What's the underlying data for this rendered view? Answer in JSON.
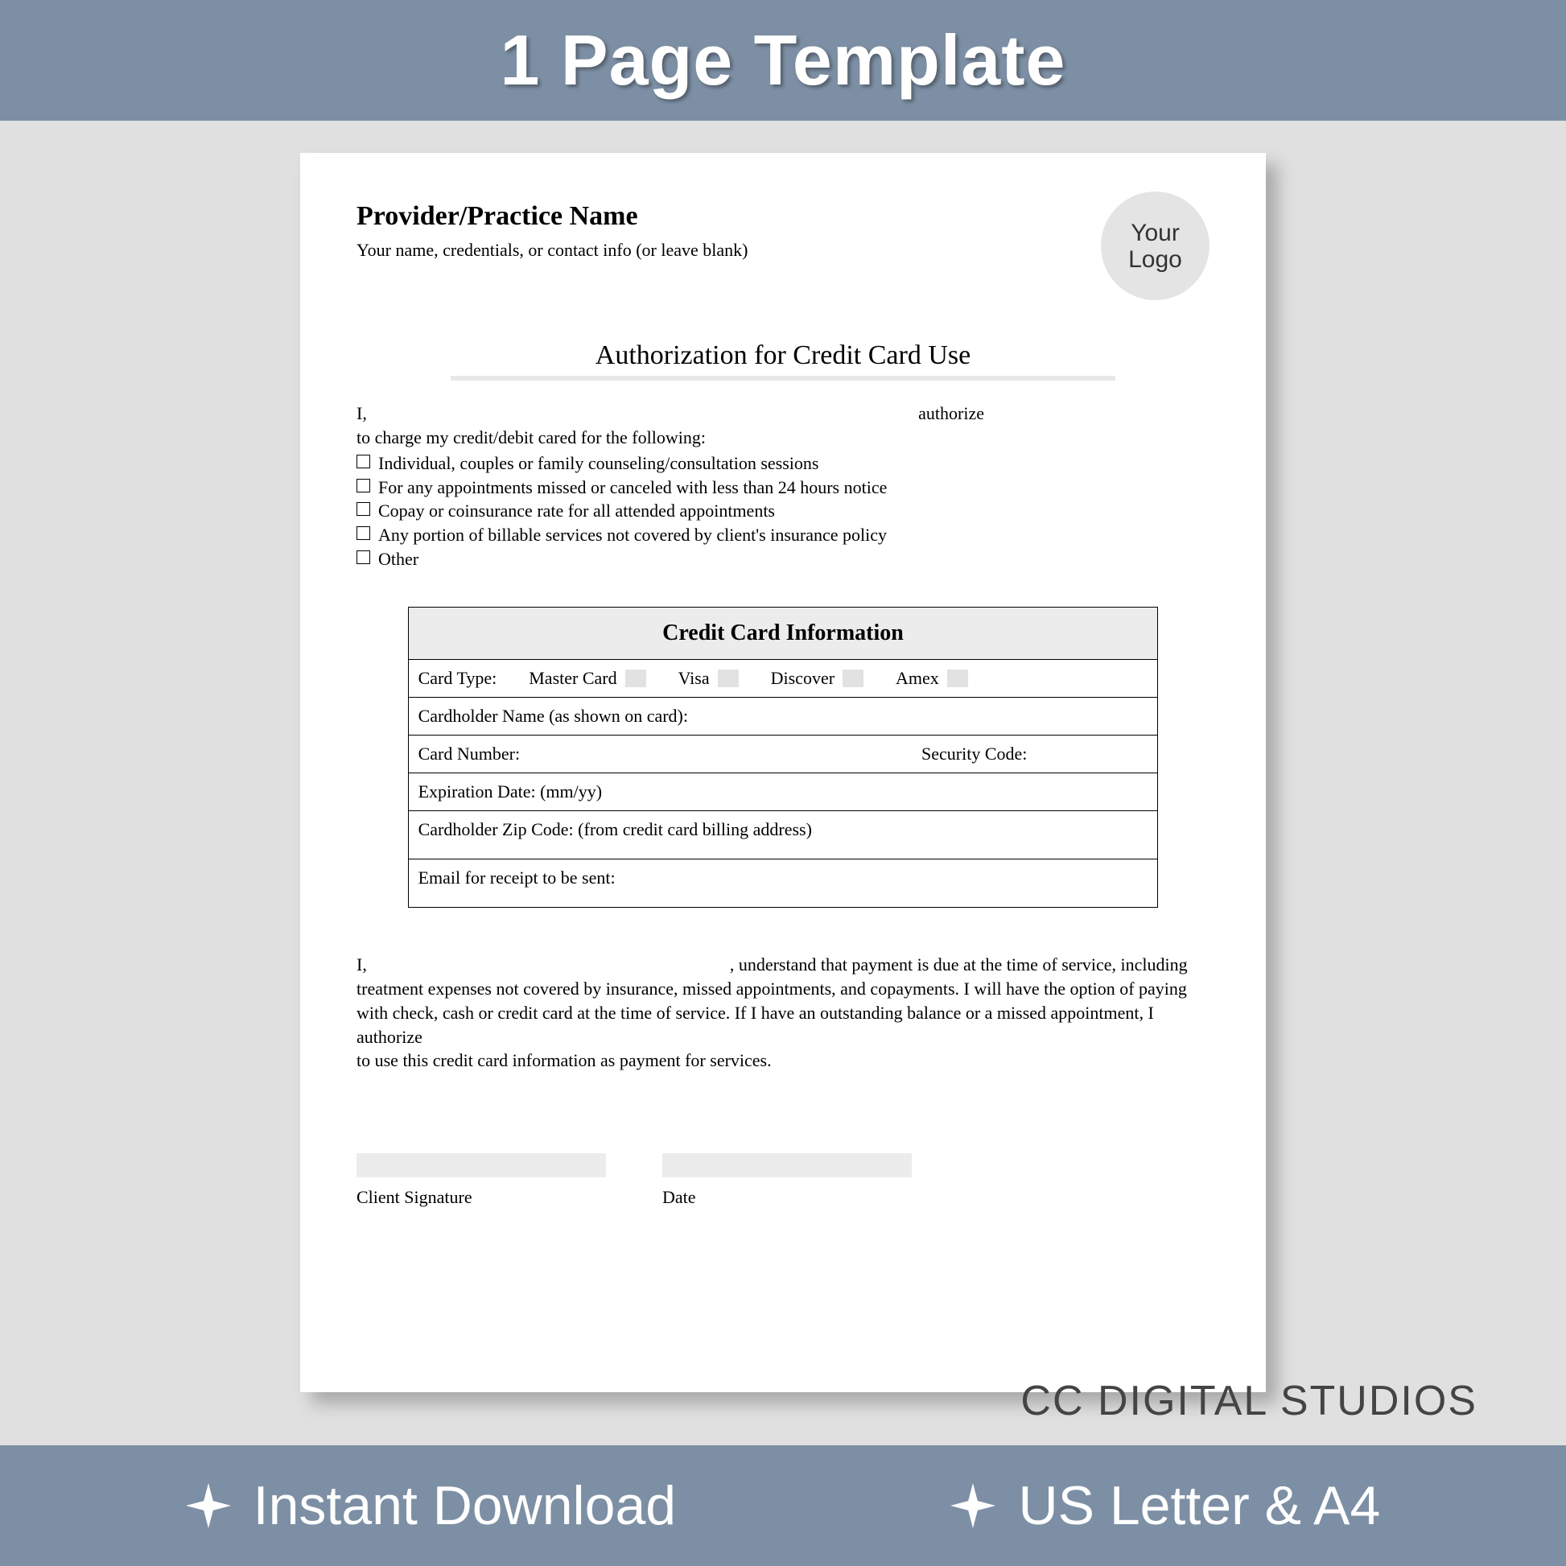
{
  "top_banner": "1 Page Template",
  "brand": "CC DIGITAL STUDIOS",
  "features": [
    "Instant Download",
    "US Letter & A4"
  ],
  "doc": {
    "provider_name": "Provider/Practice Name",
    "provider_sub": "Your name, credentials, or contact info (or leave blank)",
    "logo_text": "Your Logo",
    "title": "Authorization for Credit Card Use",
    "auth_prefix": "I,",
    "auth_suffix": "authorize",
    "intro": "to charge my credit/debit cared for the following:",
    "checks": [
      "Individual, couples or family counseling/consultation sessions",
      "For any appointments missed or canceled with less than 24 hours notice",
      "Copay or coinsurance rate for all attended appointments",
      "Any portion of billable services not covered by client's insurance policy",
      "Other"
    ],
    "cc_header": "Credit Card Information",
    "card_type_label": "Card Type:",
    "card_types": [
      "Master Card",
      "Visa",
      "Discover",
      "Amex"
    ],
    "rows": {
      "name": "Cardholder Name (as shown on card):",
      "number": "Card Number:",
      "security": "Security Code:",
      "exp": "Expiration Date: (mm/yy)",
      "zip": "Cardholder Zip Code: (from credit card billing address)",
      "email": "Email for receipt to be sent:"
    },
    "para_prefix": "I, ",
    "para_rest": ", understand that payment is due at the time of service, including treatment expenses not covered by insurance, missed appointments, and copayments. I will have the option of paying with check, cash or credit card at the time of service. If I have an outstanding balance or a missed appointment, I authorize",
    "para_last": "to use this credit card information as payment for services.",
    "sig_client": "Client Signature",
    "sig_date": "Date"
  }
}
